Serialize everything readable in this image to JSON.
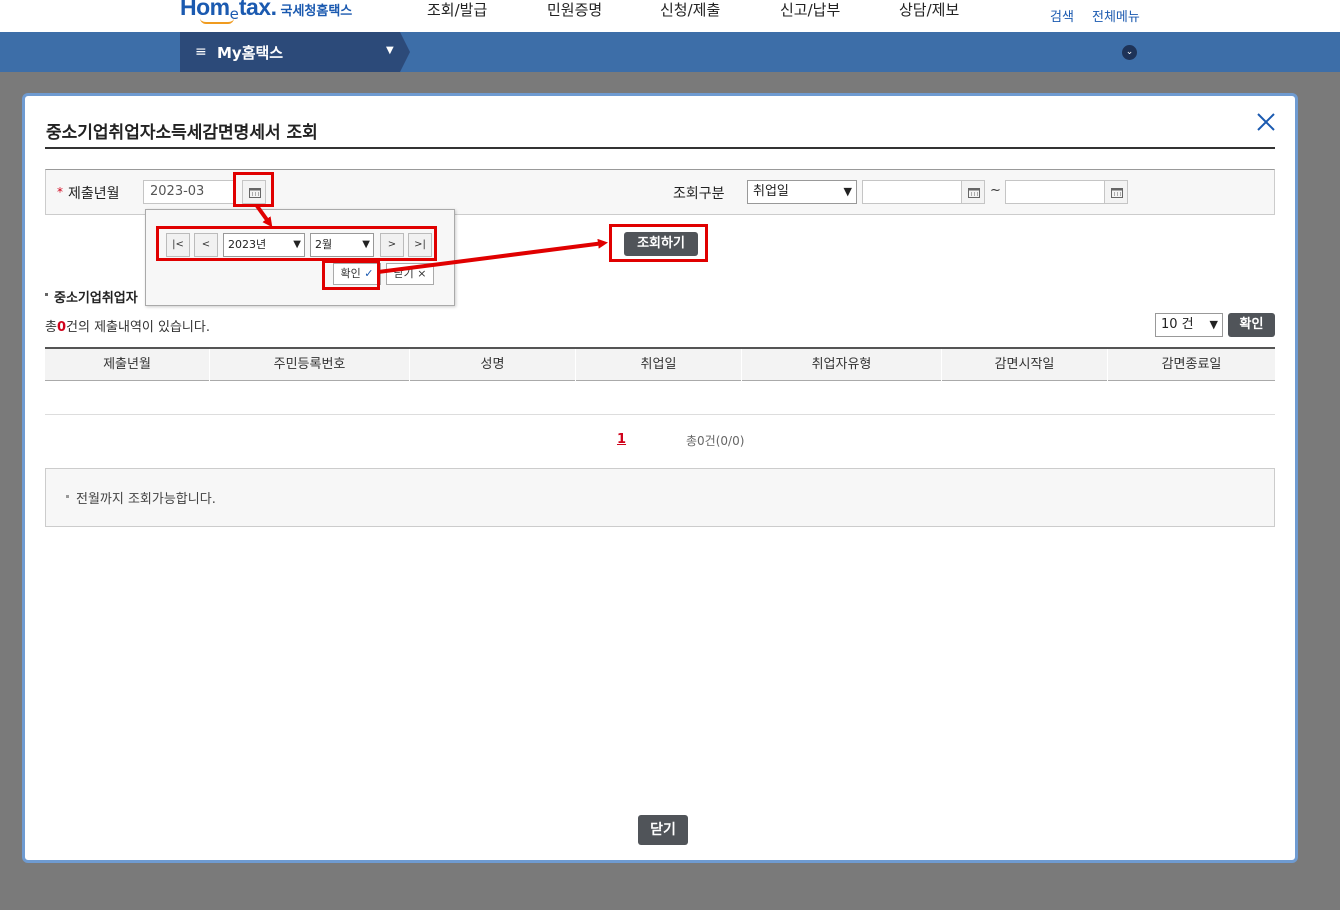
{
  "header": {
    "logo_main": "Hom",
    "logo_e": "e",
    "logo_tail": "tax.",
    "logo_sub": "국세청홈택스",
    "gnb": [
      "조회/발급",
      "민원증명",
      "신청/제출",
      "신고/납부",
      "상담/제보"
    ],
    "util": [
      "검색",
      "전체메뉴"
    ]
  },
  "navbar": {
    "menu_icon": "≡",
    "title": "My홈택스",
    "caret": "▼",
    "toggle_icon": "⌄"
  },
  "modal": {
    "title": "중소기업취업자소득세감면명세서 조회",
    "search": {
      "required_mark": "*",
      "submit_month_label": "제출년월",
      "submit_month_value": "2023-03",
      "query_type_label": "조회구분",
      "query_type_value": "취업일",
      "from_date": "",
      "to_date": "",
      "tilde": "~",
      "search_button": "조회하기"
    },
    "calendar_popup": {
      "first": "|<",
      "prev": "<",
      "year": "2023년",
      "month": "2월",
      "next": ">",
      "last": ">|",
      "confirm": "확인",
      "confirm_mark": "✓",
      "close": "닫기",
      "close_mark": "×"
    },
    "section_title": "중소기업취업자",
    "count_prefix": "총",
    "count_value": "0",
    "count_suffix": "건의 제출내역이 있습니다.",
    "page_size": "10 건",
    "page_size_confirm": "확인",
    "table": {
      "columns": [
        "제출년월",
        "주민등록번호",
        "성명",
        "취업일",
        "취업자유형",
        "감면시작일",
        "감면종료일"
      ],
      "rows": []
    },
    "paging": {
      "current_page": "1",
      "total": "총0건(0/0)"
    },
    "note": "전월까지 조회가능합니다.",
    "close_button": "닫기"
  },
  "colors": {
    "brand": "#1b5ab0",
    "nav": "#3d6ea8",
    "nav_dark": "#2c4a79",
    "modal_border": "#6f9bd1",
    "annotation_red": "#e00000",
    "dark_button": "#505459"
  }
}
